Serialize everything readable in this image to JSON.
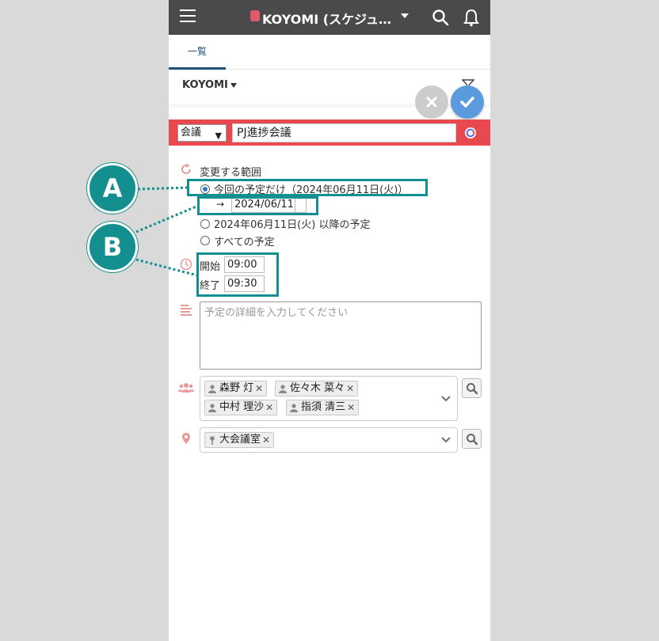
{
  "header": {
    "title": "KOYOMI (スケジュ…",
    "accent_color": "#4a4a4a"
  },
  "tabs": [
    {
      "label": "一覧"
    }
  ],
  "subheader": {
    "label": "KOYOMI"
  },
  "form": {
    "category": "会議",
    "title_value": "PJ進捗会議",
    "scope_label": "変更する範囲",
    "options": [
      {
        "label": "今回の予定だけ（2024年06月11日(火)）",
        "selected": true
      },
      {
        "label": "2024年06月11日(火) 以降の予定",
        "selected": false
      },
      {
        "label": "すべての予定",
        "selected": false
      }
    ],
    "arrow": "→",
    "date_value": "2024/06/11",
    "start_label": "開始",
    "start_value": "09:00",
    "end_label": "終了",
    "end_value": "09:30",
    "detail_placeholder": "予定の詳細を入力してください",
    "participants": [
      "森野 灯",
      "佐々木 菜々",
      "中村 理沙",
      "指須 清三"
    ],
    "locations": [
      "大会議室"
    ]
  },
  "callouts": {
    "a": "A",
    "b": "B"
  },
  "colors": {
    "red_bar": "#e8494f",
    "teal": "#138f8f",
    "save": "#5b9bdd",
    "icon_pink": "#e89a9a"
  }
}
